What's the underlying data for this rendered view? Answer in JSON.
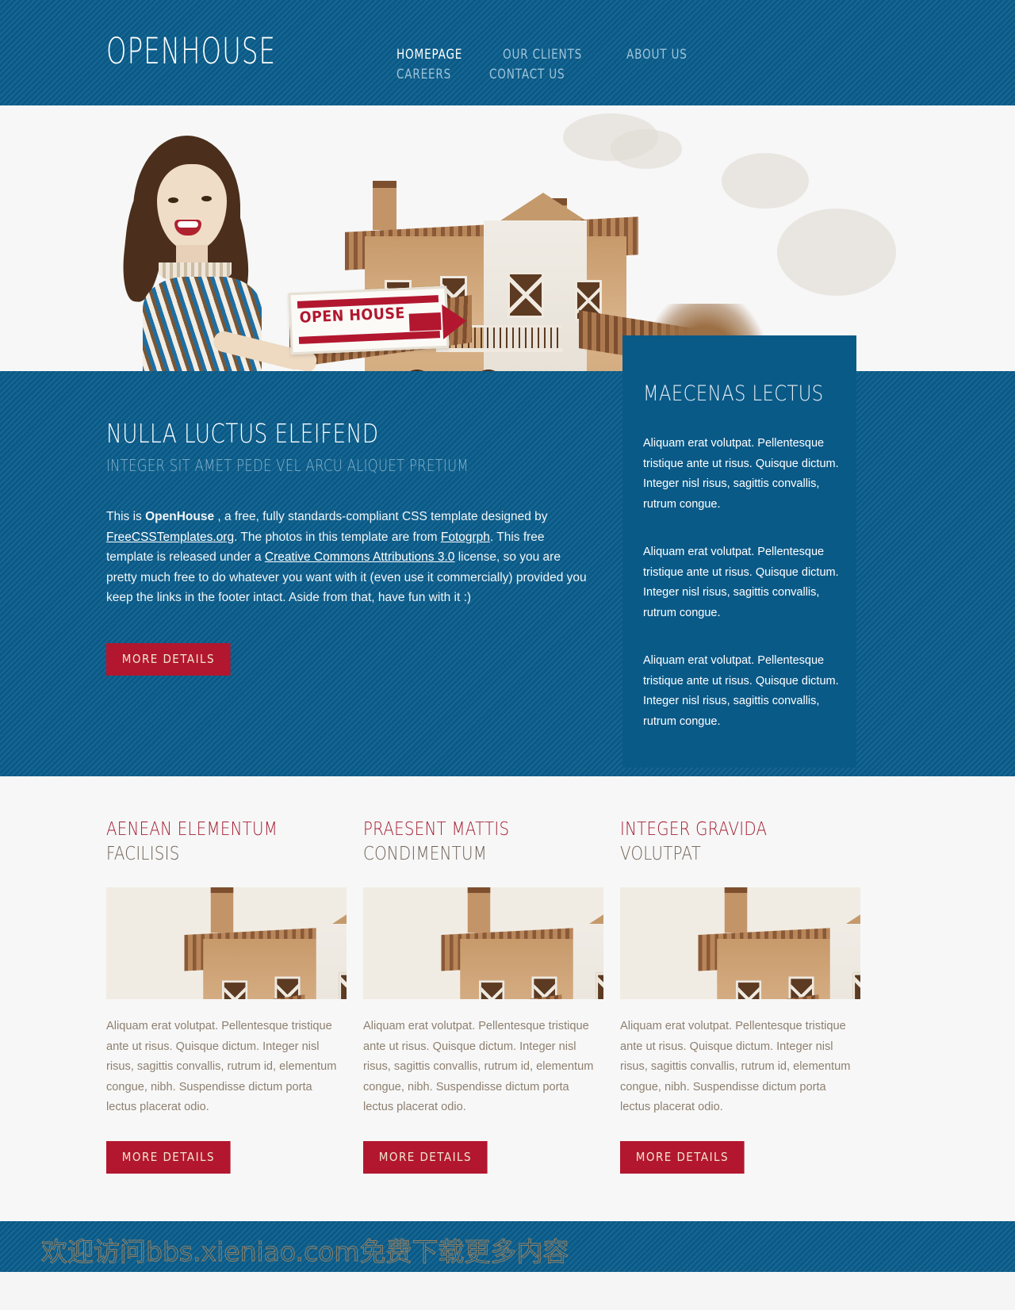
{
  "header": {
    "logo": "OPENHOUSE",
    "nav": [
      {
        "label": "HOMEPAGE",
        "current": true
      },
      {
        "label": "OUR CLIENTS",
        "current": false
      },
      {
        "label": "ABOUT US",
        "current": false
      },
      {
        "label": "CAREERS",
        "current": false
      },
      {
        "label": "CONTACT US",
        "current": false
      }
    ]
  },
  "hero": {
    "sign_text": "OPEN HOUSE"
  },
  "main": {
    "title": "NULLA LUCTUS ELEIFEND",
    "subtitle": "INTEGER SIT AMET PEDE VEL ARCU ALIQUET PRETIUM",
    "body_prefix": "This is ",
    "body_strong": "OpenHouse",
    "body_1": " , a free, fully standards-compliant CSS template designed by ",
    "link_1": "FreeCSSTemplates.org",
    "body_2": ". The photos in this template are from ",
    "link_2": "Fotogrph",
    "body_3": ". This free template is released under a ",
    "link_3": "Creative Commons Attributions 3.0",
    "body_4": " license, so you are pretty much free to do whatever you want with it (even use it commercially) provided you keep the links in the footer intact. Aside from that, have fun with it :)",
    "more_details": "MORE DETAILS"
  },
  "sidebar": {
    "title": "MAECENAS LECTUS",
    "paragraphs": [
      "Aliquam erat volutpat. Pellentesque tristique ante ut risus. Quisque dictum. Integer nisl risus, sagittis convallis, rutrum congue.",
      "Aliquam erat volutpat. Pellentesque tristique ante ut risus. Quisque dictum. Integer nisl risus, sagittis convallis, rutrum congue.",
      "Aliquam erat volutpat. Pellentesque tristique ante ut risus. Quisque dictum. Integer nisl risus, sagittis convallis, rutrum congue."
    ]
  },
  "columns": [
    {
      "title": "AENEAN ELEMENTUM",
      "subtitle": "FACILISIS",
      "text": "Aliquam erat volutpat. Pellentesque tristique ante ut risus. Quisque dictum. Integer nisl risus, sagittis convallis, rutrum id, elementum congue, nibh. Suspendisse dictum porta lectus placerat odio.",
      "button": "MORE DETAILS"
    },
    {
      "title": "PRAESENT MATTIS",
      "subtitle": "CONDIMENTUM",
      "text": "Aliquam erat volutpat. Pellentesque tristique ante ut risus. Quisque dictum. Integer nisl risus, sagittis convallis, rutrum id, elementum congue, nibh. Suspendisse dictum porta lectus placerat odio.",
      "button": "MORE DETAILS"
    },
    {
      "title": "INTEGER GRAVIDA",
      "subtitle": "VOLUTPAT",
      "text": "Aliquam erat volutpat. Pellentesque tristique ante ut risus. Quisque dictum. Integer nisl risus, sagittis convallis, rutrum id, elementum congue, nibh. Suspendisse dictum porta lectus placerat odio.",
      "button": "MORE DETAILS"
    }
  ],
  "footer": {
    "watermark": "欢迎访问bbs.xieniao.com免费下载更多内容"
  },
  "colors": {
    "blue": "#0b5e8d",
    "blue_solid": "#0a5a88",
    "red": "#b2172f",
    "heading_red": "#a41f33",
    "light_bg": "#f7f7f7"
  }
}
